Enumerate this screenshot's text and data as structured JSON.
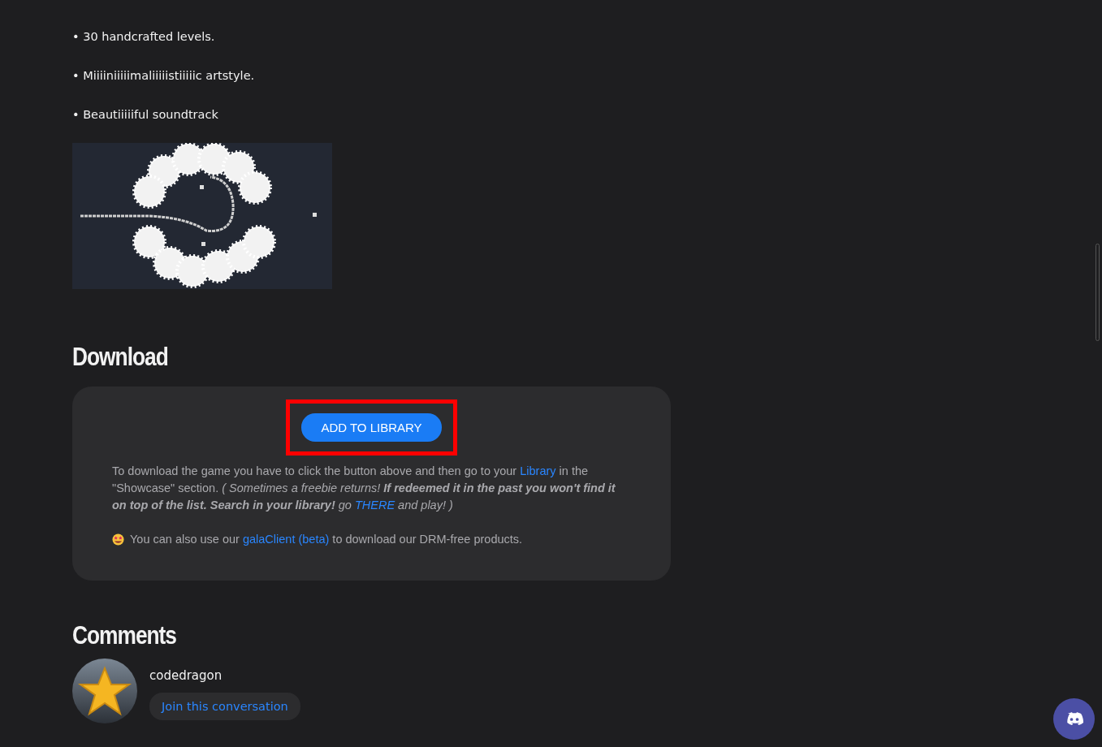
{
  "features": [
    {
      "text": "• 30 handcrafted levels."
    },
    {
      "text": "• Miiiiniiiiimaliiiiistiiiiic artstyle."
    },
    {
      "text": "• Beautiiiiiful soundtrack"
    }
  ],
  "download": {
    "heading": "Download",
    "button": {
      "label": "ADD TO LIBRARY",
      "highlighted": true
    },
    "instructions": [
      {
        "kind": "text",
        "text": "To download the game you have to click the button above and then go to your ",
        "italic": false,
        "bold": false
      },
      {
        "kind": "link",
        "text": "Library",
        "italic": false,
        "bold": false
      },
      {
        "kind": "text",
        "text": " in the \"Showcase\" section. ",
        "italic": false,
        "bold": false
      },
      {
        "kind": "text",
        "text": "( Sometimes a freebie returns! ",
        "italic": true,
        "bold": false
      },
      {
        "kind": "text",
        "text": "If redeemed it in the past you won't find it on top of the list. Search in your library!",
        "italic": true,
        "bold": true
      },
      {
        "kind": "text",
        "text": " go ",
        "italic": true,
        "bold": false
      },
      {
        "kind": "link",
        "text": "THERE",
        "italic": true,
        "bold": false
      },
      {
        "kind": "text",
        "text": " and play! )",
        "italic": true,
        "bold": false
      }
    ],
    "client_note": [
      {
        "kind": "text",
        "text": "You can also use our ",
        "italic": false,
        "bold": false
      },
      {
        "kind": "link",
        "text": "galaClient (beta)",
        "italic": false,
        "bold": false
      },
      {
        "kind": "text",
        "text": " to download our DRM-free products.",
        "italic": false,
        "bold": false
      }
    ]
  },
  "comments": {
    "heading": "Comments",
    "user": "codedragon",
    "join_button": "Join this conversation"
  }
}
